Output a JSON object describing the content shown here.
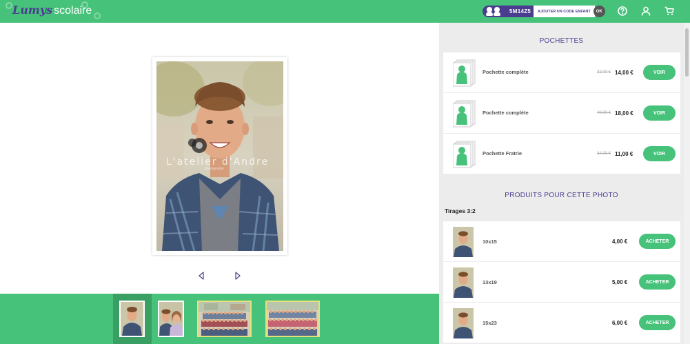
{
  "header": {
    "logo_brand": "Lumys",
    "logo_sub": "scolaire",
    "child_code": "5M14Z5",
    "add_code_label": "AJOUTER UN CODE ENFANT",
    "ok_label": "OK",
    "icons": [
      "help-icon",
      "user-icon",
      "cart-icon"
    ],
    "accent": "#46c27a",
    "brand_color": "#4a3d8f"
  },
  "viewer": {
    "watermark_line1": "L'atelier d'Andre",
    "watermark_line2": "photographe",
    "prev_icon": "triangle-left-icon",
    "next_icon": "triangle-right-icon"
  },
  "pochettes": {
    "title": "POCHETTES",
    "items": [
      {
        "label": "Pochette complète",
        "old_price": "32,00 €",
        "price": "14,00 €",
        "button": "VOIR"
      },
      {
        "label": "Pochette complète",
        "old_price": "40,00 €",
        "price": "18,00 €",
        "button": "VOIR"
      },
      {
        "label": "Pochette Fratrie",
        "old_price": "24,00 €",
        "price": "11,00 €",
        "button": "VOIR"
      }
    ]
  },
  "products": {
    "title": "PRODUITS POUR CETTE PHOTO",
    "subhead": "Tirages 3:2",
    "items": [
      {
        "label": "10x15",
        "price": "4,00 €",
        "button": "ACHETER"
      },
      {
        "label": "13x19",
        "price": "5,00 €",
        "button": "ACHETER"
      },
      {
        "label": "15x23",
        "price": "6,00 €",
        "button": "ACHETER"
      }
    ]
  }
}
